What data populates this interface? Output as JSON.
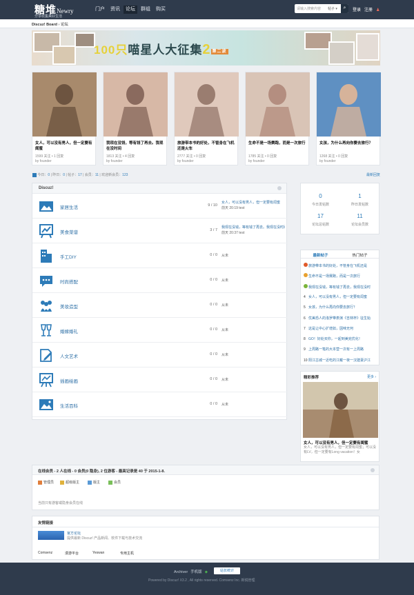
{
  "header": {
    "logo_cn": "糖堆",
    "logo_en": "Newry",
    "slogan": "分享收集美好生活",
    "nav": [
      "门户",
      "资讯",
      "论坛",
      "群组",
      "购买"
    ],
    "nav_active": 3,
    "search_placeholder": "请输入搜索内容",
    "search_scope": "帖子",
    "login": "登录",
    "register": "注册"
  },
  "breadcrumb": {
    "home": "Discuz! Board",
    "sep": "›",
    "current": "论坛"
  },
  "banner": {
    "num": "100只",
    "title": "喵星人大征集",
    "suffix": "2",
    "tag": "第二波"
  },
  "featured": [
    {
      "title": "女人，可以没有男人，但一定要有闺蜜",
      "meta": "1599 关注 • 1 回复",
      "by": "by founder",
      "colors": [
        "#a88a6c",
        "#6d5440"
      ]
    },
    {
      "title": "我现在没钱，等有钱了再去。我现在没时间",
      "meta": "1813 关注 • 4 回复",
      "by": "by founder",
      "colors": [
        "#d7b8a6",
        "#8a6a5e"
      ]
    },
    {
      "title": "旅游带本书的好处，不管身在飞机还是火车",
      "meta": "2777 关注 • 0 回复",
      "by": "by founder",
      "colors": [
        "#e0c9bc",
        "#9a7d70"
      ]
    },
    {
      "title": "生命不是一场赛跑，而是一次旅行",
      "meta": "1785 关注 • 0 回复",
      "by": "by founder",
      "colors": [
        "#d9c4b6",
        "#b48e80"
      ]
    },
    {
      "title": "女孩，为什么再向你要去旅行？",
      "meta": "1268 关注 • 0 回复",
      "by": "by founder",
      "colors": [
        "#5f90c2",
        "#d6b39a"
      ]
    }
  ],
  "stats": {
    "today_l": "今日：",
    "today": "0",
    "yest_l": "昨日：",
    "yest": "0",
    "posts_l": "帖子：",
    "posts": "17",
    "mem_l": "会员：",
    "mem": "11",
    "new_l": "欢迎新会员：",
    "new": "123"
  },
  "newest_reply": "最新回复",
  "forum": {
    "title": "Discuz!",
    "rows": [
      {
        "name": "家居生活",
        "count": "9 / 10",
        "last": "女人，可以没有男人，但一定要有闺蜜",
        "lastdate": "前天 20:19 test",
        "icon": "home-image-icon"
      },
      {
        "name": "美食菜谱",
        "count": "3 / 7",
        "last": "我现在没钱，等有钱了再去。我现在没时间",
        "lastdate": "前天 20:37 test",
        "icon": "chart-board-icon"
      },
      {
        "name": "手工DIY",
        "count": "0 / 0",
        "last": "从未",
        "lastdate": "",
        "icon": "building-icon"
      },
      {
        "name": "时尚搭配",
        "count": "0 / 0",
        "last": "从未",
        "lastdate": "",
        "icon": "chat-bubble-icon"
      },
      {
        "name": "美妆造型",
        "count": "0 / 0",
        "last": "从未",
        "lastdate": "",
        "icon": "people-icon"
      },
      {
        "name": "婚嫁婚礼",
        "count": "0 / 0",
        "last": "从未",
        "lastdate": "",
        "icon": "wine-glass-icon"
      },
      {
        "name": "人文艺术",
        "count": "0 / 0",
        "last": "从未",
        "lastdate": "",
        "icon": "pen-paper-icon"
      },
      {
        "name": "插画绘画",
        "count": "0 / 0",
        "last": "从未",
        "lastdate": "",
        "icon": "easel-icon"
      },
      {
        "name": "生活百科",
        "count": "0 / 0",
        "last": "从未",
        "lastdate": "",
        "icon": "landscape-icon"
      }
    ]
  },
  "sidestats": [
    {
      "v": "0",
      "l": "今日发帖数"
    },
    {
      "v": "1",
      "l": "昨日发帖数"
    },
    {
      "v": "17",
      "l": "论坛总帖数"
    },
    {
      "v": "11",
      "l": "论坛会员数"
    }
  ],
  "hot": {
    "tab1": "最新帖子",
    "tab2": "热门帖子",
    "items": [
      {
        "no": "",
        "t": "旅游带本书的好处，不管身在飞机还是",
        "color": "#e05a2a"
      },
      {
        "no": "",
        "t": "生命不是一场赛跑，而是一次旅行",
        "color": "#e8a12f"
      },
      {
        "no": "",
        "t": "我现在没钱，等有钱了再去，我现在没时",
        "color": "#7ab43a"
      },
      {
        "no": "4",
        "t": "女人，可以没有男人，但一定要有闺蜜",
        "color": ""
      },
      {
        "no": "5",
        "t": "女孩，为什么再向你要去旅行？",
        "color": ""
      },
      {
        "no": "6",
        "t": "优美恐人的洛罗带表演《吉林杯》征生始",
        "color": ""
      },
      {
        "no": "7",
        "t": "这是让中心扩增如，因味无何",
        "color": ""
      },
      {
        "no": "8",
        "t": "GO！好处买你，一起到美完优化！",
        "color": ""
      },
      {
        "no": "9",
        "t": "上周路一笔的大本营一次有一上周路",
        "color": ""
      },
      {
        "no": "10",
        "t": "阳江古城一近吃的江戴一夜一汉建妻沪江",
        "color": ""
      }
    ]
  },
  "rec": {
    "title": "精彩推荐",
    "more": "更多 ›",
    "post": "女人，可以没有男人，但一定要有闺蜜",
    "desc": "女人，可以没有男人，但一定要有闺蜜；可以没有LV，但一定要有Long vacation！女"
  },
  "online": {
    "title": "在线会员 - 2 人在线 - 0 会员(0 隐身), 2 位游客 - 最高记录是 40 于 2015-1-8.",
    "legend": [
      {
        "t": "管理员",
        "c": "#e07e3c"
      },
      {
        "t": "超级版主",
        "c": "#e0b23c"
      },
      {
        "t": "版主",
        "c": "#5a9ad6"
      },
      {
        "t": "会员",
        "c": "#7abf5a"
      }
    ],
    "note": "当前只有游客或隐身会员在线"
  },
  "links": {
    "title": "友情链接",
    "name": "官方论坛",
    "desc": "提供最新 Discuz! 产品新闻、软件下载与技术交流",
    "row": [
      "Comsenz",
      "漫游平台",
      "Yeswan",
      "专用主机"
    ]
  },
  "footer": {
    "archiver": "Archiver",
    "mobile": "手机版",
    "badge": "站长统计",
    "copy": "Powered by Discuz! X3.2 , All rights reserved. Comsenz Inc. 新锐管理"
  }
}
